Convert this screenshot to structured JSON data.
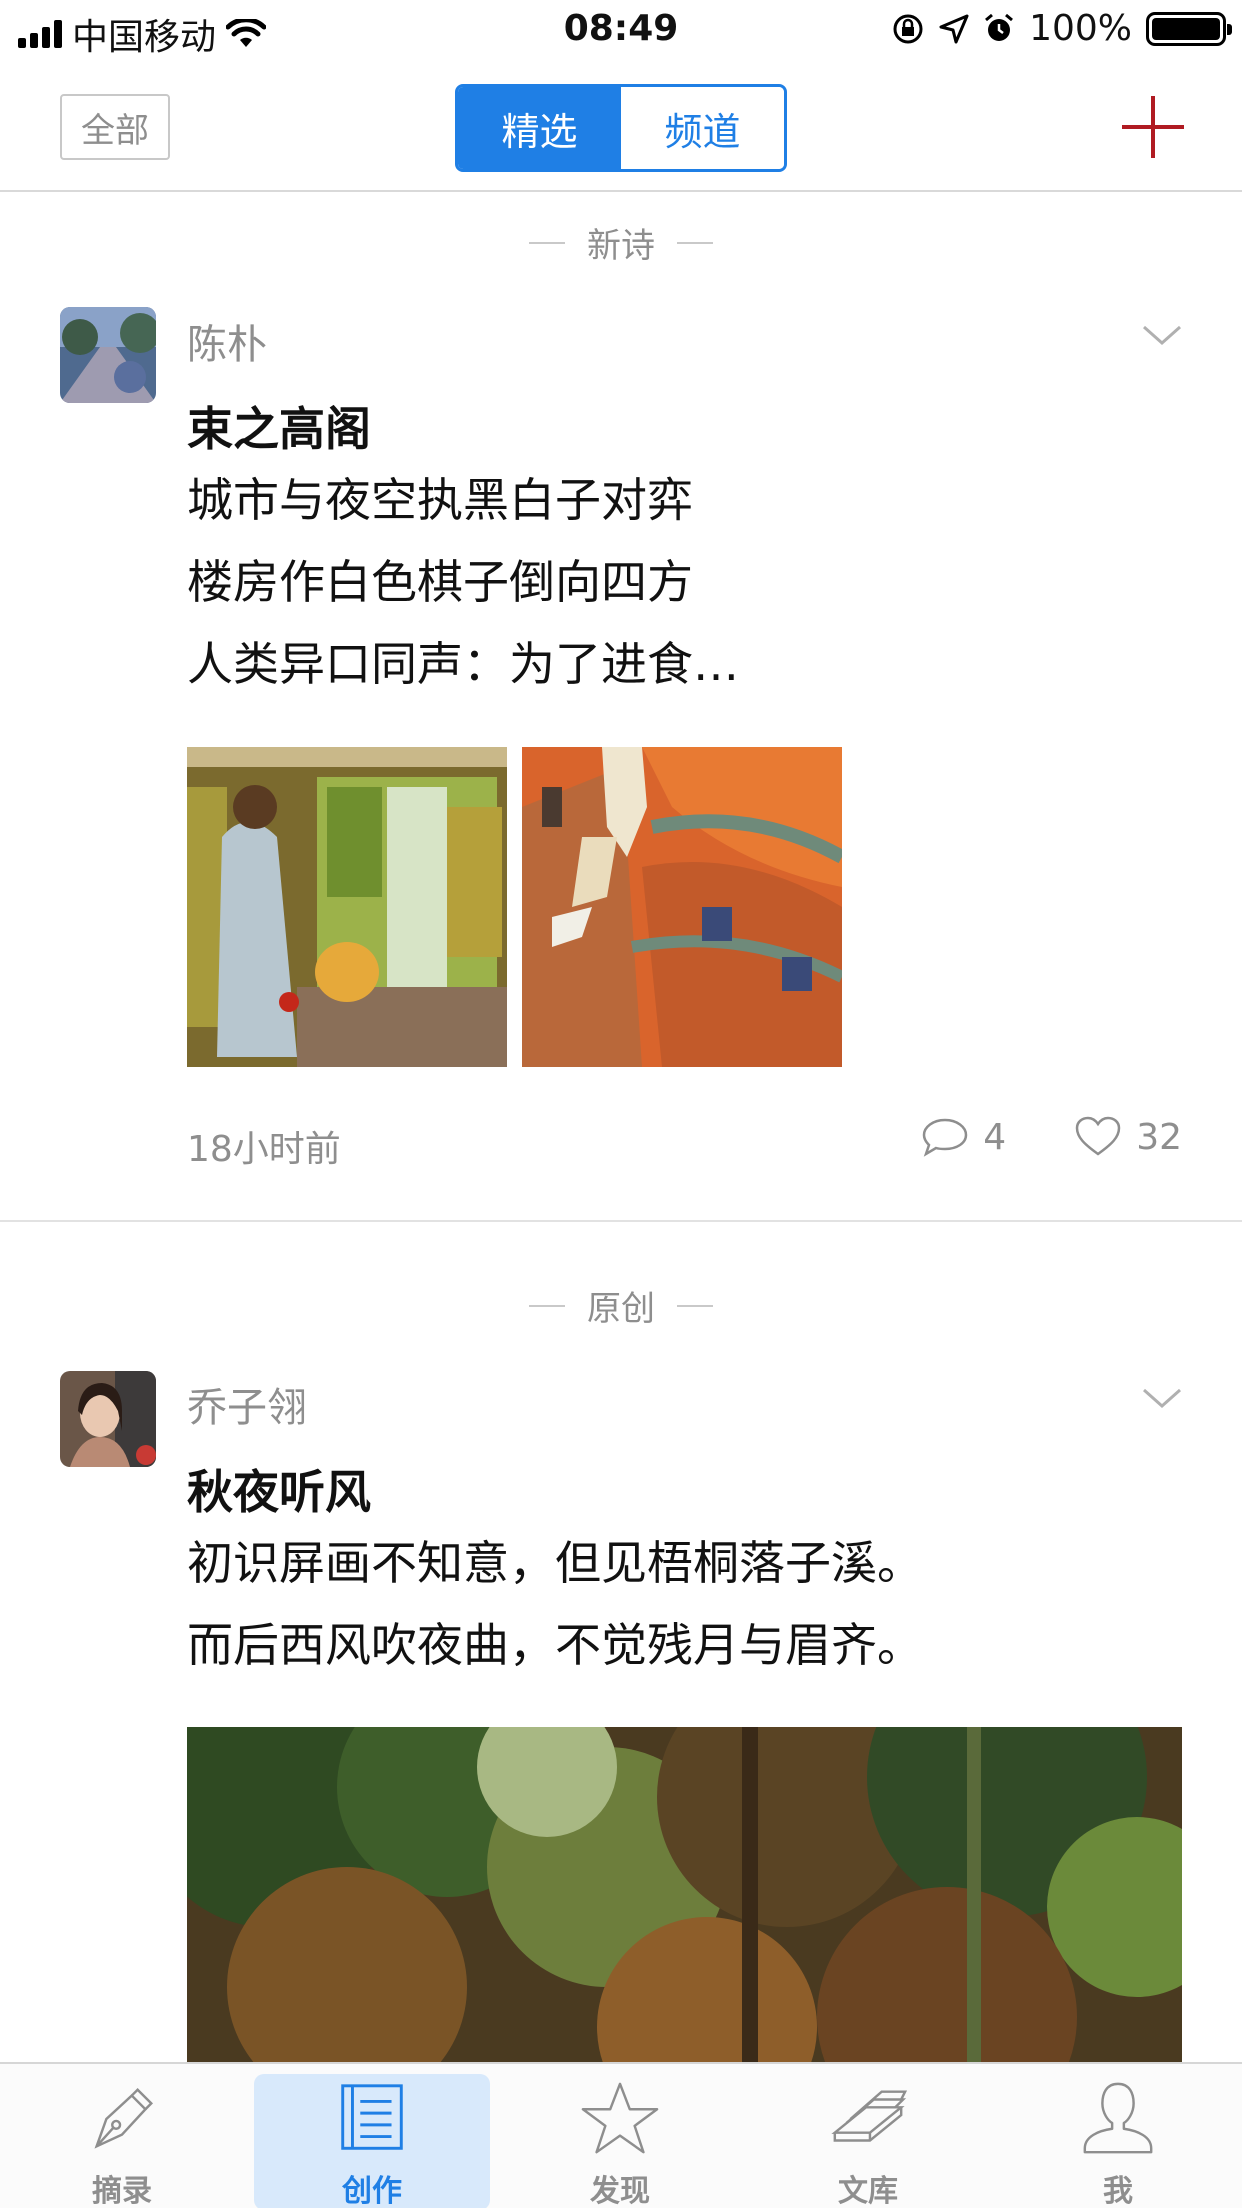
{
  "status_bar": {
    "carrier": "中国移动",
    "time": "08:49",
    "battery": "100%"
  },
  "nav": {
    "all_label": "全部",
    "segment_selected": "精选",
    "segment_other": "频道"
  },
  "feed": [
    {
      "section": "新诗",
      "author": "陈朴",
      "title": "束之高阁",
      "lines": [
        "城市与夜空执黑白子对弈",
        "楼房作白色棋子倒向四方",
        "人类异口同声：为了进食…"
      ],
      "time": "18小时前",
      "comments": "4",
      "likes": "32"
    },
    {
      "section": "原创",
      "author": "乔子翎",
      "title": "秋夜听风",
      "lines": [
        "初识屏画不知意，但见梧桐落子溪。",
        "而后西风吹夜曲，不觉残月与眉齐。"
      ]
    }
  ],
  "tabs": [
    {
      "label": "摘录",
      "icon": "pen-nib-icon"
    },
    {
      "label": "创作",
      "icon": "document-icon",
      "active": true
    },
    {
      "label": "发现",
      "icon": "star-icon"
    },
    {
      "label": "文库",
      "icon": "books-icon"
    },
    {
      "label": "我",
      "icon": "person-icon"
    }
  ],
  "colors": {
    "accent": "#1f7fe5",
    "plus": "#b01b22",
    "muted": "#8e8e8e"
  }
}
